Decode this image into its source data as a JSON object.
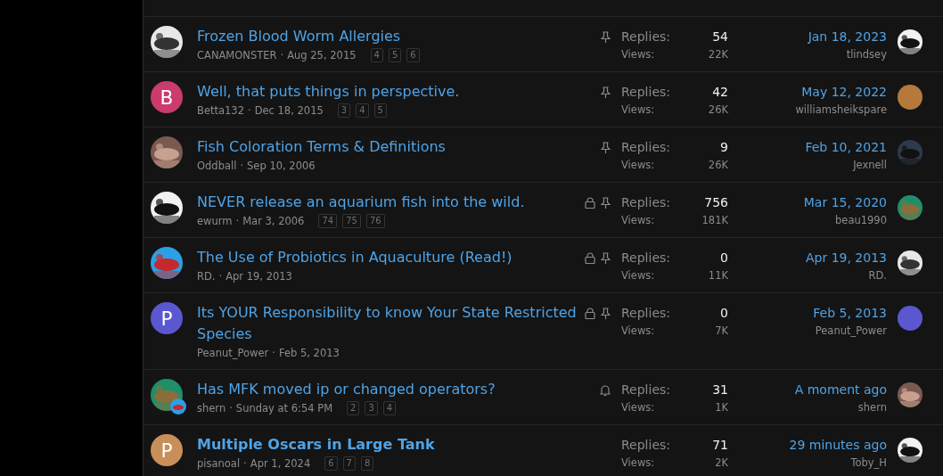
{
  "threads": [
    {
      "title": "Frozen Blood Worm Allergies",
      "unread": false,
      "author": "CANAMONSTER",
      "separator": "·",
      "date": "Aug 25, 2015",
      "pages": [
        "4",
        "5",
        "6"
      ],
      "locked": false,
      "sticky": true,
      "watched": false,
      "replies_label": "Replies:",
      "replies": "54",
      "views_label": "Views:",
      "views": "22K",
      "last_date": "Jan 18, 2023",
      "last_user": "tlindsey",
      "avatar": {
        "kind": "picture"
      },
      "last_avatar": {
        "kind": "picture"
      }
    },
    {
      "title": "Well, that puts things in perspective.",
      "unread": false,
      "author": "Betta132",
      "separator": "·",
      "date": "Dec 18, 2015",
      "pages": [
        "3",
        "4",
        "5"
      ],
      "locked": false,
      "sticky": true,
      "watched": false,
      "replies_label": "Replies:",
      "replies": "42",
      "views_label": "Views:",
      "views": "26K",
      "last_date": "May 12, 2022",
      "last_user": "williamsheikspare",
      "avatar": {
        "kind": "letter",
        "letter": "B",
        "color": "#cc3b6e"
      },
      "last_avatar": {
        "kind": "color",
        "color": "#b5793c"
      }
    },
    {
      "title": "Fish Coloration Terms & Definitions",
      "unread": false,
      "author": "Oddball",
      "separator": "·",
      "date": "Sep 10, 2006",
      "locked": false,
      "sticky": true,
      "watched": false,
      "replies_label": "Replies:",
      "replies": "9",
      "views_label": "Views:",
      "views": "26K",
      "last_date": "Feb 10, 2021",
      "last_user": "Jexnell",
      "avatar": {
        "kind": "picture"
      },
      "last_avatar": {
        "kind": "picture"
      }
    },
    {
      "title": "NEVER release an aquarium fish into the wild.",
      "unread": false,
      "author": "ewurm",
      "separator": "·",
      "date": "Mar 3, 2006",
      "pages": [
        "74",
        "75",
        "76"
      ],
      "locked": true,
      "sticky": true,
      "watched": false,
      "replies_label": "Replies:",
      "replies": "756",
      "views_label": "Views:",
      "views": "181K",
      "last_date": "Mar 15, 2020",
      "last_user": "beau1990",
      "avatar": {
        "kind": "picture"
      },
      "last_avatar": {
        "kind": "picture"
      }
    },
    {
      "title": "The Use of Probiotics in Aquaculture (Read!)",
      "unread": false,
      "author": "RD.",
      "separator": "·",
      "date": "Apr 19, 2013",
      "locked": true,
      "sticky": true,
      "watched": false,
      "replies_label": "Replies:",
      "replies": "0",
      "views_label": "Views:",
      "views": "11K",
      "last_date": "Apr 19, 2013",
      "last_user": "RD.",
      "avatar": {
        "kind": "picture"
      },
      "last_avatar": {
        "kind": "picture"
      }
    },
    {
      "title": "Its YOUR Responsibility to know Your State Restricted Species",
      "unread": false,
      "author": "Peanut_Power",
      "separator": "·",
      "date": "Feb 5, 2013",
      "locked": true,
      "sticky": true,
      "watched": false,
      "replies_label": "Replies:",
      "replies": "0",
      "views_label": "Views:",
      "views": "7K",
      "last_date": "Feb 5, 2013",
      "last_user": "Peanut_Power",
      "avatar": {
        "kind": "letter",
        "letter": "P",
        "color": "#5b57d1"
      },
      "last_avatar": {
        "kind": "color",
        "color": "#5b57d1"
      }
    },
    {
      "title": "Has MFK moved ip or changed operators?",
      "unread": false,
      "author": "shern",
      "separator": "·",
      "date": "Sunday at 6:54 PM",
      "pages": [
        "2",
        "3",
        "4"
      ],
      "locked": false,
      "sticky": false,
      "watched": true,
      "replies_label": "Replies:",
      "replies": "31",
      "views_label": "Views:",
      "views": "1K",
      "last_date": "A moment ago",
      "last_user": "shern",
      "avatar": {
        "kind": "picture",
        "badge": true
      },
      "last_avatar": {
        "kind": "picture"
      }
    },
    {
      "title": "Multiple Oscars in Large Tank",
      "unread": true,
      "author": "pisanoal",
      "separator": "·",
      "date": "Apr 1, 2024",
      "pages": [
        "6",
        "7",
        "8"
      ],
      "locked": false,
      "sticky": false,
      "watched": false,
      "replies_label": "Replies:",
      "replies": "71",
      "views_label": "Views:",
      "views": "2K",
      "last_date": "29 minutes ago",
      "last_user": "Toby_H",
      "avatar": {
        "kind": "letter",
        "letter": "P",
        "color": "#c98f5a"
      },
      "last_avatar": {
        "kind": "picture"
      }
    }
  ]
}
